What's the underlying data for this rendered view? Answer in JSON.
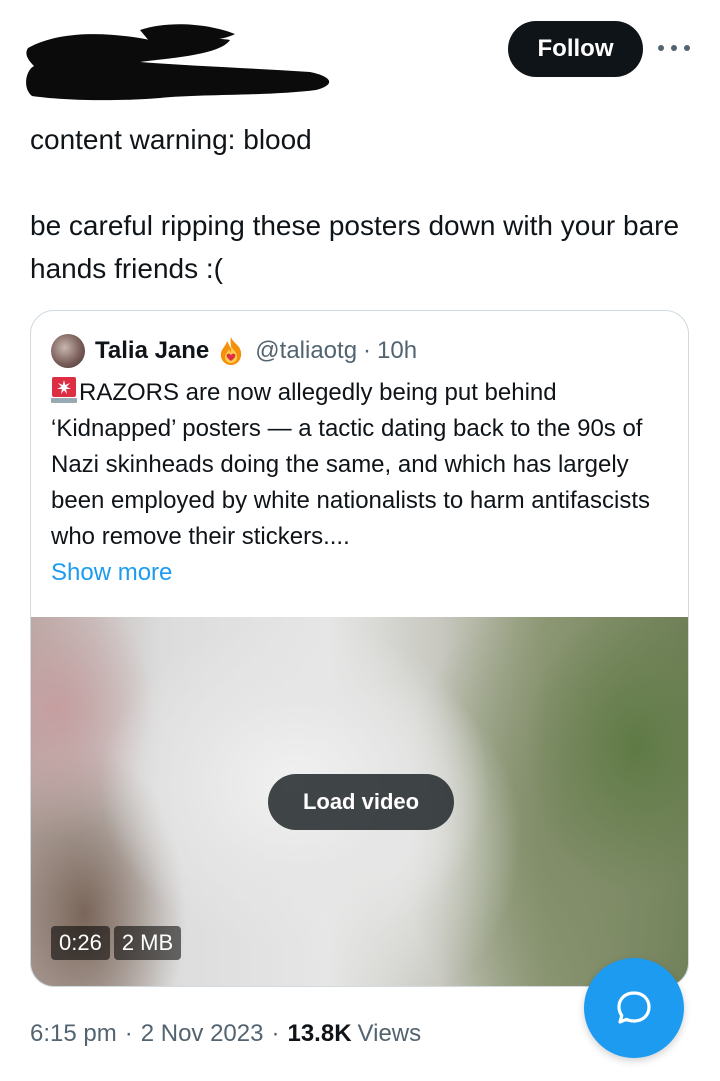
{
  "post": {
    "follow_label": "Follow",
    "more_icon": "more-horizontal-icon",
    "text_line1": "content warning: blood",
    "text_line2": "be careful ripping these posters down with your bare hands friends :("
  },
  "quoted_post": {
    "author_name": "Talia Jane",
    "author_handle": "@taliaotg",
    "separator": "·",
    "time_ago": "10h",
    "badge_icon": "flame-heart-icon",
    "lead_icon": "siren-icon",
    "body": "RAZORS are now allegedly being put behind ‘Kidnapped’ posters — a tactic dating back to the 90s of Nazi skinheads doing the same, and which has largely been employed by white nationalists to harm antifascists who remove their stickers....",
    "show_more_label": "Show more",
    "media": {
      "load_video_label": "Load video",
      "duration": "0:26",
      "size": "2 MB"
    }
  },
  "meta": {
    "time": "6:15 pm",
    "separator": "·",
    "date": "2 Nov 2023",
    "views_count": "13.8K",
    "views_label": "Views"
  },
  "fab": {
    "icon": "chat-bubble-icon"
  },
  "colors": {
    "accent": "#1d9bf0",
    "text_primary": "#0f1419",
    "text_secondary": "#536471",
    "border": "#cfd9de"
  }
}
